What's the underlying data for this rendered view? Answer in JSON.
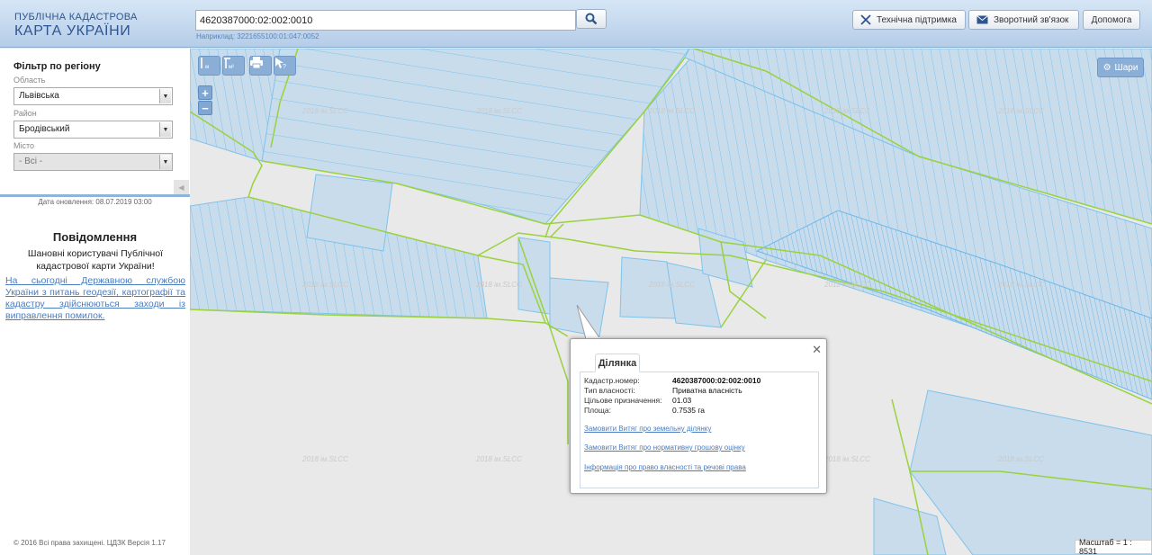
{
  "header": {
    "logo_line1": "ПУБЛІЧНА КАДАСТРОВА",
    "logo_line2": "КАРТА УКРАЇНИ",
    "search_value": "4620387000:02:002:0010",
    "search_hint": "Наприклад: 3221655100:01:047:0052",
    "buttons": {
      "support": "Технічна підтримка",
      "feedback": "Зворотний зв'язок",
      "help": "Допомога"
    }
  },
  "sidebar": {
    "filter_title": "Фільтр по регіону",
    "oblast_label": "Область",
    "oblast_value": "Львівська",
    "raion_label": "Район",
    "raion_value": "Бродівський",
    "misto_label": "Місто",
    "misto_value": "- Всі -",
    "update_date": "Дата оновлення: 08.07.2019 03:00",
    "notice_title": "Повідомлення",
    "notice_greeting": "Шановні користувачі Публічної кадастрової карти України!",
    "notice_link": "На сьогодні Державною службою України з питань геодезії, картографії та кадастру здійснюються заходи із виправлення помилок.",
    "copyright": "© 2016 Всі права захищені. ЦДЗК Версія 1.17"
  },
  "map": {
    "layers_label": "Шари",
    "scale_text": "Масштаб = 1 : 8531",
    "watermark": "2018 ім.SLCC",
    "tools": [
      "ruler-icon",
      "area-icon",
      "print-icon",
      "identify-icon"
    ]
  },
  "popup": {
    "tab": "Ділянка",
    "rows": [
      {
        "key": "Кадастр.номер:",
        "value": "4620387000:02:002:0010"
      },
      {
        "key": "Тип власності:",
        "value": "Приватна власність"
      },
      {
        "key": "Цільове призначення:",
        "value": "01.03"
      },
      {
        "key": "Площа:",
        "value": "0.7535 га"
      }
    ],
    "links": [
      "Замовити Витяг про земельну ділянку",
      "Замовити Витяг про нормативну грошову оцінку",
      "Інформація про право власності та речові права"
    ]
  },
  "colors": {
    "parcel_fill": "#c5d9ea",
    "parcel_line": "#7ec3ec",
    "boundary": "#99d23c",
    "link": "#4a7cc0"
  }
}
